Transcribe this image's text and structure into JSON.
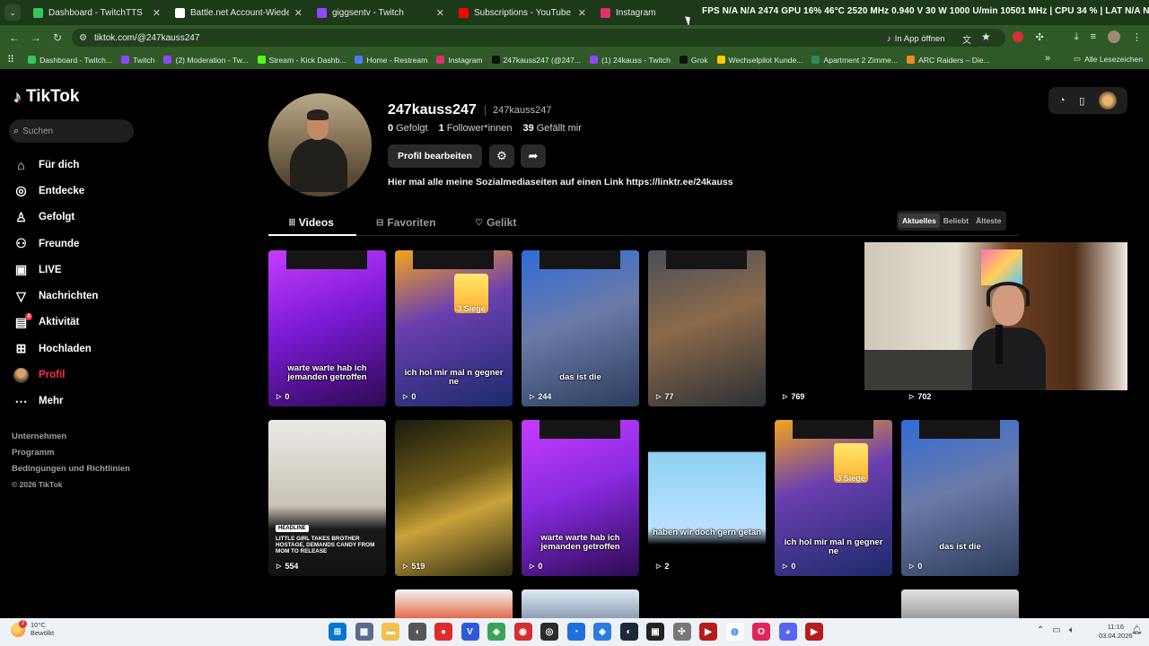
{
  "browser": {
    "tabs": [
      {
        "title": "Dashboard - TwitchTTS",
        "color": "#34c759"
      },
      {
        "title": "Battle.net Account-Wiederherstellung",
        "color": "#ffffff"
      },
      {
        "title": "giggsentv - Twitch",
        "color": "#9146ff"
      },
      {
        "title": "Subscriptions - YouTube",
        "color": "#ff0000"
      },
      {
        "title": "Instagram",
        "color": "#e1306c"
      }
    ],
    "osd_text": "FPS N/A  N/A 2474 GPU 16% 46°C 2520 MHz 0.940 V 30 W 1000 U/min 10501 MHz | CPU 34 % | LAT N/A N/A",
    "url": "tiktok.com/@247kauss247",
    "open_in_app": "In App öffnen",
    "bookmarks": [
      {
        "label": "Dashboard - Twitch...",
        "color": "#34c759"
      },
      {
        "label": "Twitch",
        "color": "#9146ff"
      },
      {
        "label": "(2) Moderation - Tw...",
        "color": "#9146ff"
      },
      {
        "label": "Stream - Kick Dashb...",
        "color": "#53fc18"
      },
      {
        "label": "Home - Restream",
        "color": "#4d7cff"
      },
      {
        "label": "Instagram",
        "color": "#e1306c"
      },
      {
        "label": "247kauss247 (@247...",
        "color": "#111111"
      },
      {
        "label": "(1) 24kauss - Twitch",
        "color": "#9146ff"
      },
      {
        "label": "Grok",
        "color": "#111111"
      },
      {
        "label": "Wechselpilot Kunde...",
        "color": "#ffcc00"
      },
      {
        "label": "Apartment 2 Zimme...",
        "color": "#2e8b57"
      },
      {
        "label": "ARC Raiders – Die...",
        "color": "#f08a24"
      }
    ],
    "all_bookmarks": "Alle Lesezeichen"
  },
  "sidebar": {
    "logo": "TikTok",
    "search_placeholder": "Suchen",
    "items": [
      {
        "label": "Für dich",
        "icon": "home-icon",
        "glyph": "⌂"
      },
      {
        "label": "Entdecke",
        "icon": "compass-icon",
        "glyph": "◎"
      },
      {
        "label": "Gefolgt",
        "icon": "user-plus-icon",
        "glyph": "♙"
      },
      {
        "label": "Freunde",
        "icon": "friends-icon",
        "glyph": "⚇"
      },
      {
        "label": "LIVE",
        "icon": "live-icon",
        "glyph": "▣"
      },
      {
        "label": "Nachrichten",
        "icon": "messages-icon",
        "glyph": "▽"
      },
      {
        "label": "Aktivität",
        "icon": "activity-icon",
        "glyph": "▤",
        "badge": "3"
      },
      {
        "label": "Hochladen",
        "icon": "upload-icon",
        "glyph": "⊞"
      },
      {
        "label": "Profil",
        "icon": "profile-avatar-icon",
        "active": true
      },
      {
        "label": "Mehr",
        "icon": "more-icon",
        "glyph": "⋯"
      }
    ],
    "footer": [
      "Unternehmen",
      "Programm",
      "Bedingungen und Richtlinien",
      "© 2026 TikTok"
    ]
  },
  "profile": {
    "username": "247kauss247",
    "handle": "247kauss247",
    "following_count": "0",
    "following_label": "Gefolgt",
    "followers_count": "1",
    "followers_label": "Follower*innen",
    "likes_count": "39",
    "likes_label": "Gefällt mir",
    "edit_label": "Profil bearbeiten",
    "bio": "Hier mal alle meine Sozialmediaseiten auf einen Link https://linktr.ee/24kauss"
  },
  "tabs": {
    "videos": "Videos",
    "favorites": "Favoriten",
    "liked": "Gelikt"
  },
  "sort": {
    "newest": "Aktuelles",
    "popular": "Beliebt",
    "oldest": "Älteste"
  },
  "videos": [
    {
      "caption": "warte warte hab ich jemanden getroffen",
      "views": "0",
      "bg": "linear-gradient(160deg,#c63cff 0%,#7b1bd6 45%,#2d0a52 100%)"
    },
    {
      "caption": "ich hol mir mal n gegner ne",
      "views": "0",
      "bg": "linear-gradient(160deg,#f3a51c 0%,#6b3fb0 40%,#1b2a6b 100%)",
      "badge": "3 Siege"
    },
    {
      "caption": "das ist die",
      "views": "244",
      "bg": "linear-gradient(160deg,#2f6bd6 0%,#6b7ba8 45%,#2b3c5c 100%)"
    },
    {
      "caption": "",
      "views": "77",
      "bg": "linear-gradient(160deg,#4a4f58 0%,#8a6a4a 45%,#2b2f35 100%)"
    },
    {
      "caption": "",
      "views": "769",
      "bg": "#000000"
    },
    {
      "caption": "",
      "views": "702",
      "bg": "#000000"
    },
    {
      "caption": "",
      "views": "554",
      "bg": "linear-gradient(180deg,#eceae6 0%,#c9c2b6 55%,#1a1a1a 70%,#111 100%)",
      "headline": "HEADLINE",
      "headline_text": "LITTLE GIRL TAKES BROTHER HOSTAGE, DEMANDS CANDY FROM MOM TO RELEASE"
    },
    {
      "caption": "",
      "views": "519",
      "bg": "linear-gradient(160deg,#1a1a0e 0%,#6b5a18 40%,#c9a23a 60%,#2a2a12 100%)"
    },
    {
      "caption": "warte warte hab ich jemanden getroffen",
      "views": "0",
      "bg": "linear-gradient(160deg,#c63cff 0%,#8a2be2 45%,#2d0a52 100%)"
    },
    {
      "caption": "haben wir doch gern getan",
      "views": "2",
      "bg": "linear-gradient(180deg,#000 0%,#000 20%,#8fd0f0 21%,#b9e2ff 70%,#000 80%)"
    },
    {
      "caption": "ich hol mir mal n gegner ne",
      "views": "0",
      "bg": "linear-gradient(160deg,#f3a51c 0%,#6b3fb0 40%,#1b2a6b 100%)",
      "badge": "3 Siege"
    },
    {
      "caption": "das ist die",
      "views": "0",
      "bg": "linear-gradient(160deg,#2f6bd6 0%,#6b7ba8 45%,#2b3c5c 100%)"
    }
  ],
  "taskbar": {
    "temperature": "10°C",
    "weather_text": "Bewölkt",
    "weather_badge": "2",
    "time": "11:16",
    "date": "03.04.2026",
    "apps": [
      {
        "name": "windows-start-icon",
        "color": "#0078d4",
        "glyph": "⊞"
      },
      {
        "name": "calculator-icon",
        "color": "#5b6b8a",
        "glyph": "▦"
      },
      {
        "name": "file-explorer-icon",
        "color": "#f2c14e",
        "glyph": "▬"
      },
      {
        "name": "mouse-app-icon",
        "color": "#555555",
        "glyph": "◖"
      },
      {
        "name": "red-app-icon",
        "color": "#e02b2b",
        "glyph": "●"
      },
      {
        "name": "v-app-icon",
        "color": "#2d5bd8",
        "glyph": "V"
      },
      {
        "name": "layers-app-icon",
        "color": "#3aa35a",
        "glyph": "◆"
      },
      {
        "name": "recorder-app-icon",
        "color": "#d32f2f",
        "glyph": "◉"
      },
      {
        "name": "obs-icon",
        "color": "#2b2b2b",
        "glyph": "◎"
      },
      {
        "name": "edge-app-icon",
        "color": "#1f6fe0",
        "glyph": "◔"
      },
      {
        "name": "blue-app-icon",
        "color": "#2a7de1",
        "glyph": "◈"
      },
      {
        "name": "steam-icon",
        "color": "#1b2838",
        "glyph": "◐"
      },
      {
        "name": "terminal-app-icon",
        "color": "#222222",
        "glyph": "▣"
      },
      {
        "name": "puzzle-app-icon",
        "color": "#777777",
        "glyph": "✣"
      },
      {
        "name": "stream-app-icon",
        "color": "#b71c1c",
        "glyph": "▶"
      },
      {
        "name": "chrome-icon",
        "color": "#ffffff",
        "glyph": "◍"
      },
      {
        "name": "opera-icon",
        "color": "#e0245e",
        "glyph": "O"
      },
      {
        "name": "discord-icon",
        "color": "#5865f2",
        "glyph": "◕"
      },
      {
        "name": "stream2-app-icon",
        "color": "#b71c1c",
        "glyph": "▶"
      }
    ]
  },
  "colors": {
    "tiktok_red": "#fe2c55",
    "chrome_green": "#2f5a28"
  }
}
